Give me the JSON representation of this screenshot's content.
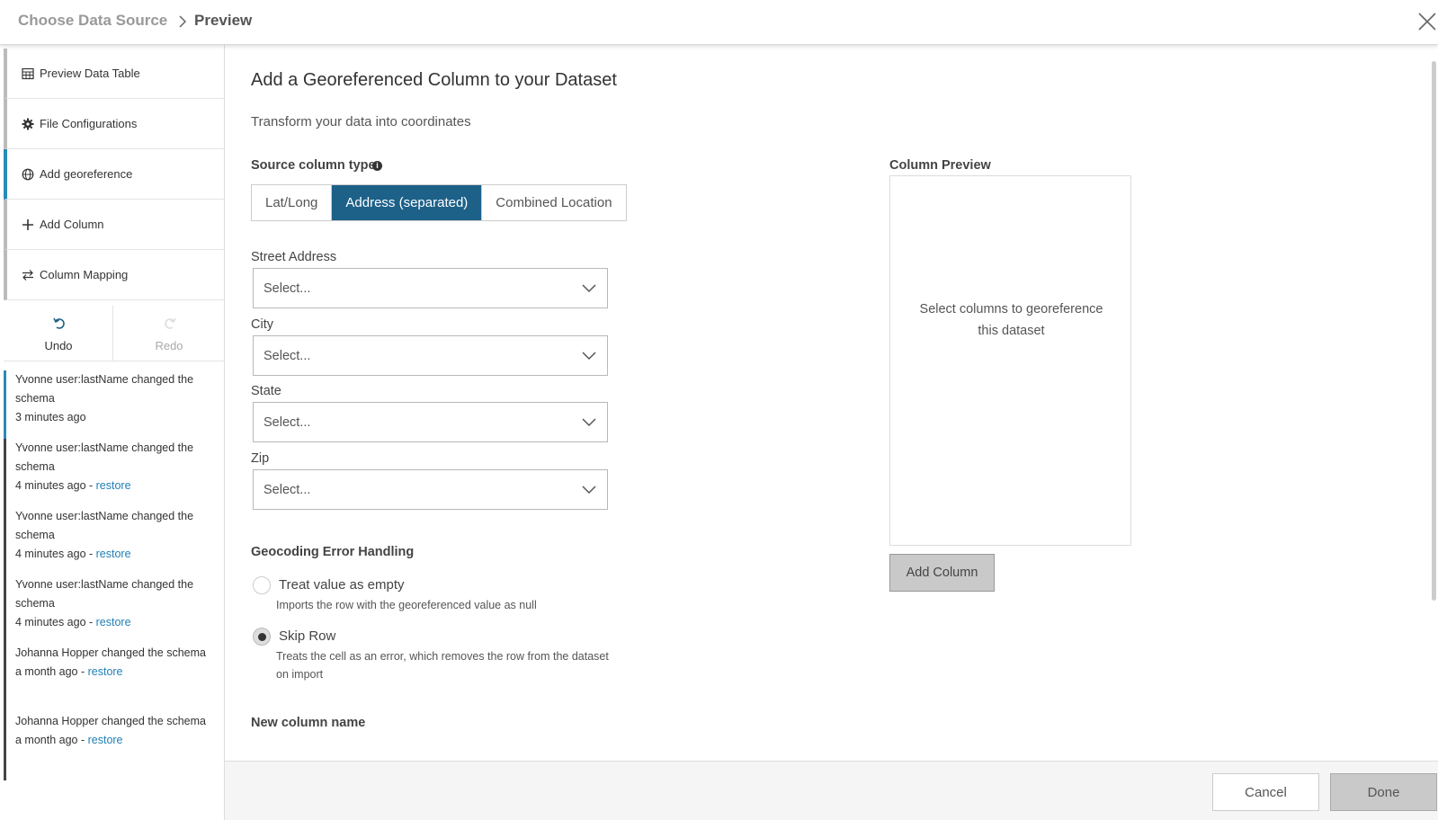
{
  "header": {
    "breadcrumb_parent": "Choose Data Source",
    "breadcrumb_current": "Preview"
  },
  "sidebar": {
    "items": [
      {
        "label": "Preview Data Table",
        "icon": "table-icon"
      },
      {
        "label": "File Configurations",
        "icon": "gear-icon"
      },
      {
        "label": "Add georeference",
        "icon": "globe-icon",
        "active": true
      },
      {
        "label": "Add Column",
        "icon": "plus-icon"
      },
      {
        "label": "Column Mapping",
        "icon": "swap-icon"
      }
    ],
    "undo_label": "Undo",
    "redo_label": "Redo"
  },
  "history": [
    {
      "text": "Yvonne user:lastName changed the schema",
      "time": "3 minutes ago",
      "restore": ""
    },
    {
      "text": "Yvonne user:lastName changed the schema",
      "time": "4 minutes ago - ",
      "restore": "restore"
    },
    {
      "text": "Yvonne user:lastName changed the schema",
      "time": "4 minutes ago - ",
      "restore": "restore"
    },
    {
      "text": "Yvonne user:lastName changed the schema",
      "time": "4 minutes ago - ",
      "restore": "restore"
    },
    {
      "text": "Johanna Hopper changed the schema",
      "time": "a month ago - ",
      "restore": "restore"
    },
    {
      "text": "Johanna Hopper changed the schema",
      "time": "a month ago - ",
      "restore": "restore"
    }
  ],
  "main": {
    "title": "Add a Georeferenced Column to your Dataset",
    "subtitle": "Transform your data into coordinates",
    "source_type_label": "Source column type",
    "source_types": [
      "Lat/Long",
      "Address (separated)",
      "Combined Location"
    ],
    "source_type_selected": "Address (separated)",
    "fields": [
      {
        "label": "Street Address",
        "placeholder": "Select..."
      },
      {
        "label": "City",
        "placeholder": "Select..."
      },
      {
        "label": "State",
        "placeholder": "Select..."
      },
      {
        "label": "Zip",
        "placeholder": "Select..."
      }
    ],
    "error_handling_label": "Geocoding Error Handling",
    "options": [
      {
        "title": "Treat value as empty",
        "desc": "Imports the row with the georeferenced value as null",
        "checked": false
      },
      {
        "title": "Skip Row",
        "desc": "Treats the cell as an error, which removes the row from the dataset on import",
        "checked": true
      }
    ],
    "new_column_label": "New column name",
    "preview": {
      "label": "Column Preview",
      "empty_text": "Select columns to georeference this dataset",
      "add_button": "Add Column"
    }
  },
  "footer": {
    "cancel_label": "Cancel",
    "done_label": "Done"
  },
  "colors": {
    "accent": "#2b8ab8",
    "segment_active": "#1d6189",
    "link": "#1f7fb6"
  }
}
